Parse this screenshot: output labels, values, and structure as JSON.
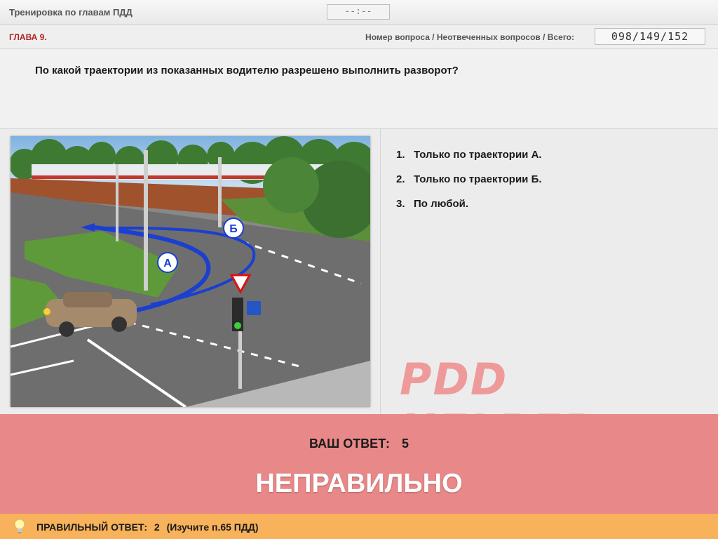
{
  "app": {
    "title": "Тренировка по главам ПДД",
    "timer": "--:--"
  },
  "chapter": {
    "label": "ГЛАВА 9.",
    "counter_label": "Номер вопроса / Неотвеченных вопросов / Всего:",
    "counter_value": "098/149/152"
  },
  "question": {
    "text": "По какой траектории из показанных водителю разрешено выполнить разворот?"
  },
  "image": {
    "label_a": "А",
    "label_b": "Б"
  },
  "answers": [
    {
      "num": "1.",
      "text": "Только по траектории А."
    },
    {
      "num": "2.",
      "text": "Только по траектории Б."
    },
    {
      "num": "3.",
      "text": "По любой."
    }
  ],
  "watermark": "PDD HELPER",
  "result": {
    "your_answer_label": "ВАШ  ОТВЕТ:",
    "your_answer_value": "5",
    "verdict": "НЕПРАВИЛЬНО"
  },
  "hint": {
    "icon": "lightbulb-icon",
    "label": "ПРАВИЛЬНЫЙ ОТВЕТ:",
    "value": "2",
    "note": "(Изучите п.65 ПДД)"
  },
  "colors": {
    "result_bg": "#e98888",
    "hint_bg": "#f7b25b",
    "chapter_red": "#b22222",
    "watermark": "#ee9a9a"
  }
}
